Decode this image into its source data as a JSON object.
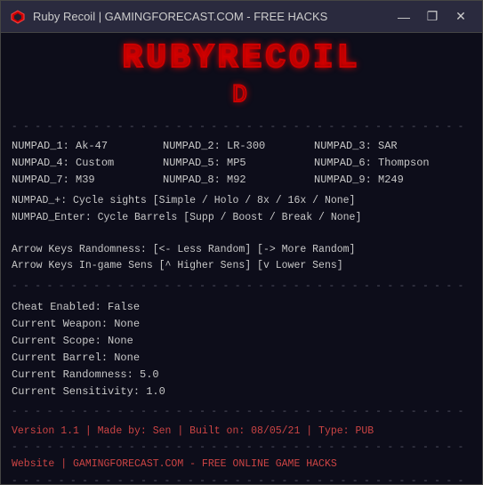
{
  "window": {
    "title": "Ruby Recoil | GAMINGFORECAST.COM - FREE HACKS",
    "icon_color": "#cc0000"
  },
  "titlebar": {
    "minimize_label": "—",
    "maximize_label": "❐",
    "close_label": "✕"
  },
  "banner": {
    "line1": "RUBYRECOIL",
    "line2": "D"
  },
  "keybinds": {
    "rows": [
      [
        {
          "key": "NUMPAD_1",
          "value": "Ak-47"
        },
        {
          "key": "NUMPAD_2",
          "value": "LR-300"
        },
        {
          "key": "NUMPAD_3",
          "value": "SAR"
        }
      ],
      [
        {
          "key": "NUMPAD_4",
          "value": "Custom"
        },
        {
          "key": "NUMPAD_5",
          "value": "MP5"
        },
        {
          "key": "NUMPAD_6",
          "value": "Thompson"
        }
      ],
      [
        {
          "key": "NUMPAD_7",
          "value": "M39"
        },
        {
          "key": "NUMPAD_8",
          "value": "M92"
        },
        {
          "key": "NUMPAD_9",
          "value": "M249"
        }
      ]
    ]
  },
  "descriptions": [
    "NUMPAD_+: Cycle sights [Simple / Holo / 8x / 16x / None]",
    "NUMPAD_Enter: Cycle Barrels [Supp / Boost / Break / None]",
    "",
    "Arrow Keys Randomness: [<- Less Random] [-> More Random]",
    "Arrow Keys In-game Sens [^ Higher Sens] [v Lower Sens]"
  ],
  "status": {
    "cheat_enabled": "Cheat Enabled: False",
    "current_weapon": "Current Weapon: None",
    "current_scope": "Current Scope: None",
    "current_barrel": "Current Barrel: None",
    "current_randomness": "Current Randomness: 5.0",
    "current_sensitivity": "Current Sensitivity: 1.0"
  },
  "footer": {
    "version_line": "Version 1.1 | Made by: Sen | Built on: 08/05/21 | Type: PUB",
    "website_line": "Website | GAMINGFORECAST.COM - FREE ONLINE GAME HACKS"
  },
  "divider_char": "- - - - - - - - - - - - - - - - - - - - - - - - - - - - - - - - - - - -"
}
